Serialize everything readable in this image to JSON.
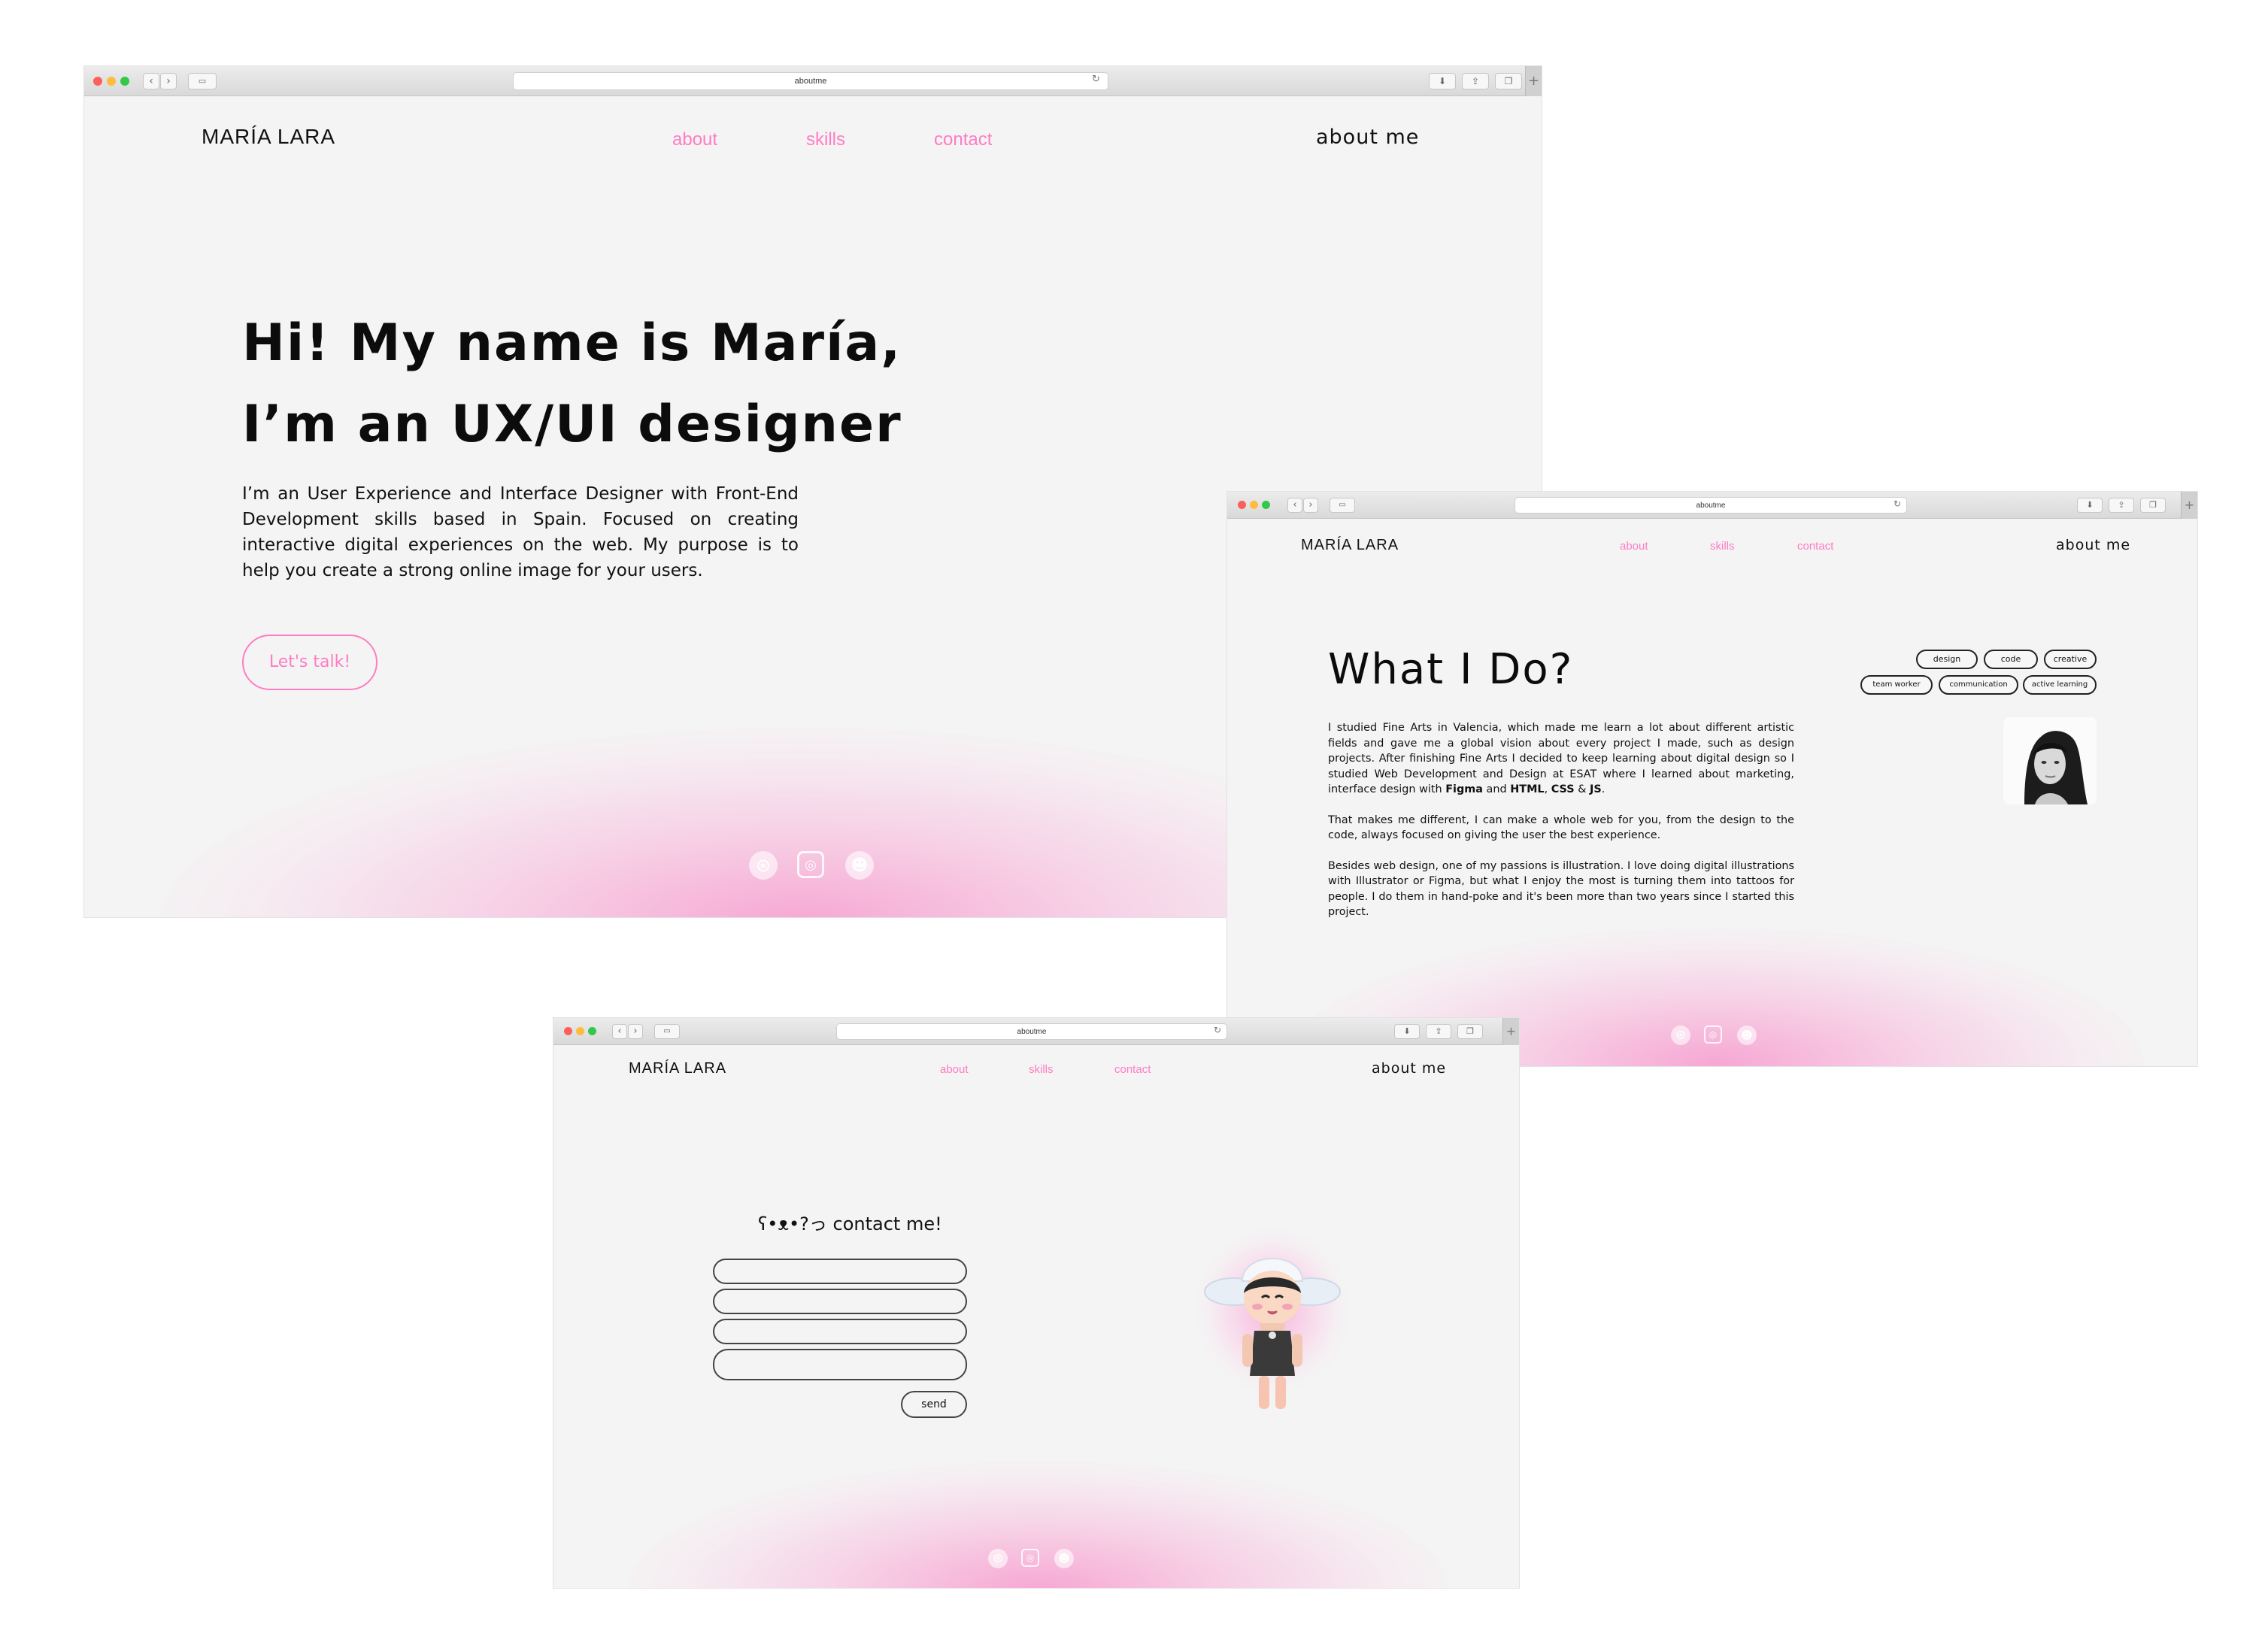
{
  "browser": {
    "url": "aboutme"
  },
  "brand": {
    "name": "MARÍA LARA"
  },
  "nav": {
    "about": "about",
    "skills": "skills",
    "contact": "contact",
    "page_title": "about me"
  },
  "hero": {
    "line1": "Hi! My name is María,",
    "line2": "I’m an UX/UI designer",
    "paragraph": "I’m an User Experience and Interface Designer with Front-End Development skills based in Spain. Focused on creating interactive digital experiences on the web. My purpose is to help you create a strong online image for your users.",
    "cta": "Let's talk!"
  },
  "whatido": {
    "title": "What I Do?",
    "tags_row1": [
      "design",
      "code",
      "creative"
    ],
    "tags_row2": [
      "team worker",
      "communication",
      "active learning"
    ],
    "p1_part1": "I studied Fine Arts in Valencia, which made me learn a lot about different artistic fields and gave me a global vision about every project I made, such as design projects. After finishing Fine Arts I decided to keep learning about digital design so I studied Web Development and Design at ESAT where I learned about marketing, interface design with ",
    "p1_figma": "Figma",
    "p1_and": " and ",
    "p1_html": "HTML",
    "p1_comma": ", ",
    "p1_css": "CSS",
    "p1_amp": " & ",
    "p1_js": "JS",
    "p1_end": ".",
    "p2": "That makes me different, I can make a whole web for you, from the design to the code, always focused on giving the user the best experience.",
    "p3": "Besides web design, one of my passions is illustration. I love doing digital illustrations with Illustrator or Figma, but what I enjoy the most is turning them into tattoos for people. I do them in hand-poke and it's been more than two years since I started this project."
  },
  "contact": {
    "kaomoji": "ʕ•ᴥ•?っ",
    "heading": "contact me!",
    "send": "send"
  },
  "icons": {
    "social": [
      "dribbble-icon",
      "instagram-icon",
      "github-icon"
    ],
    "chrome": [
      "back-icon",
      "forward-icon",
      "sidebar-icon",
      "reload-icon",
      "download-icon",
      "share-icon",
      "tabs-icon",
      "new-tab-icon"
    ]
  },
  "colors": {
    "accent": "#ff7cc4",
    "glow": "#f79ace",
    "background": "#f4f4f4"
  }
}
